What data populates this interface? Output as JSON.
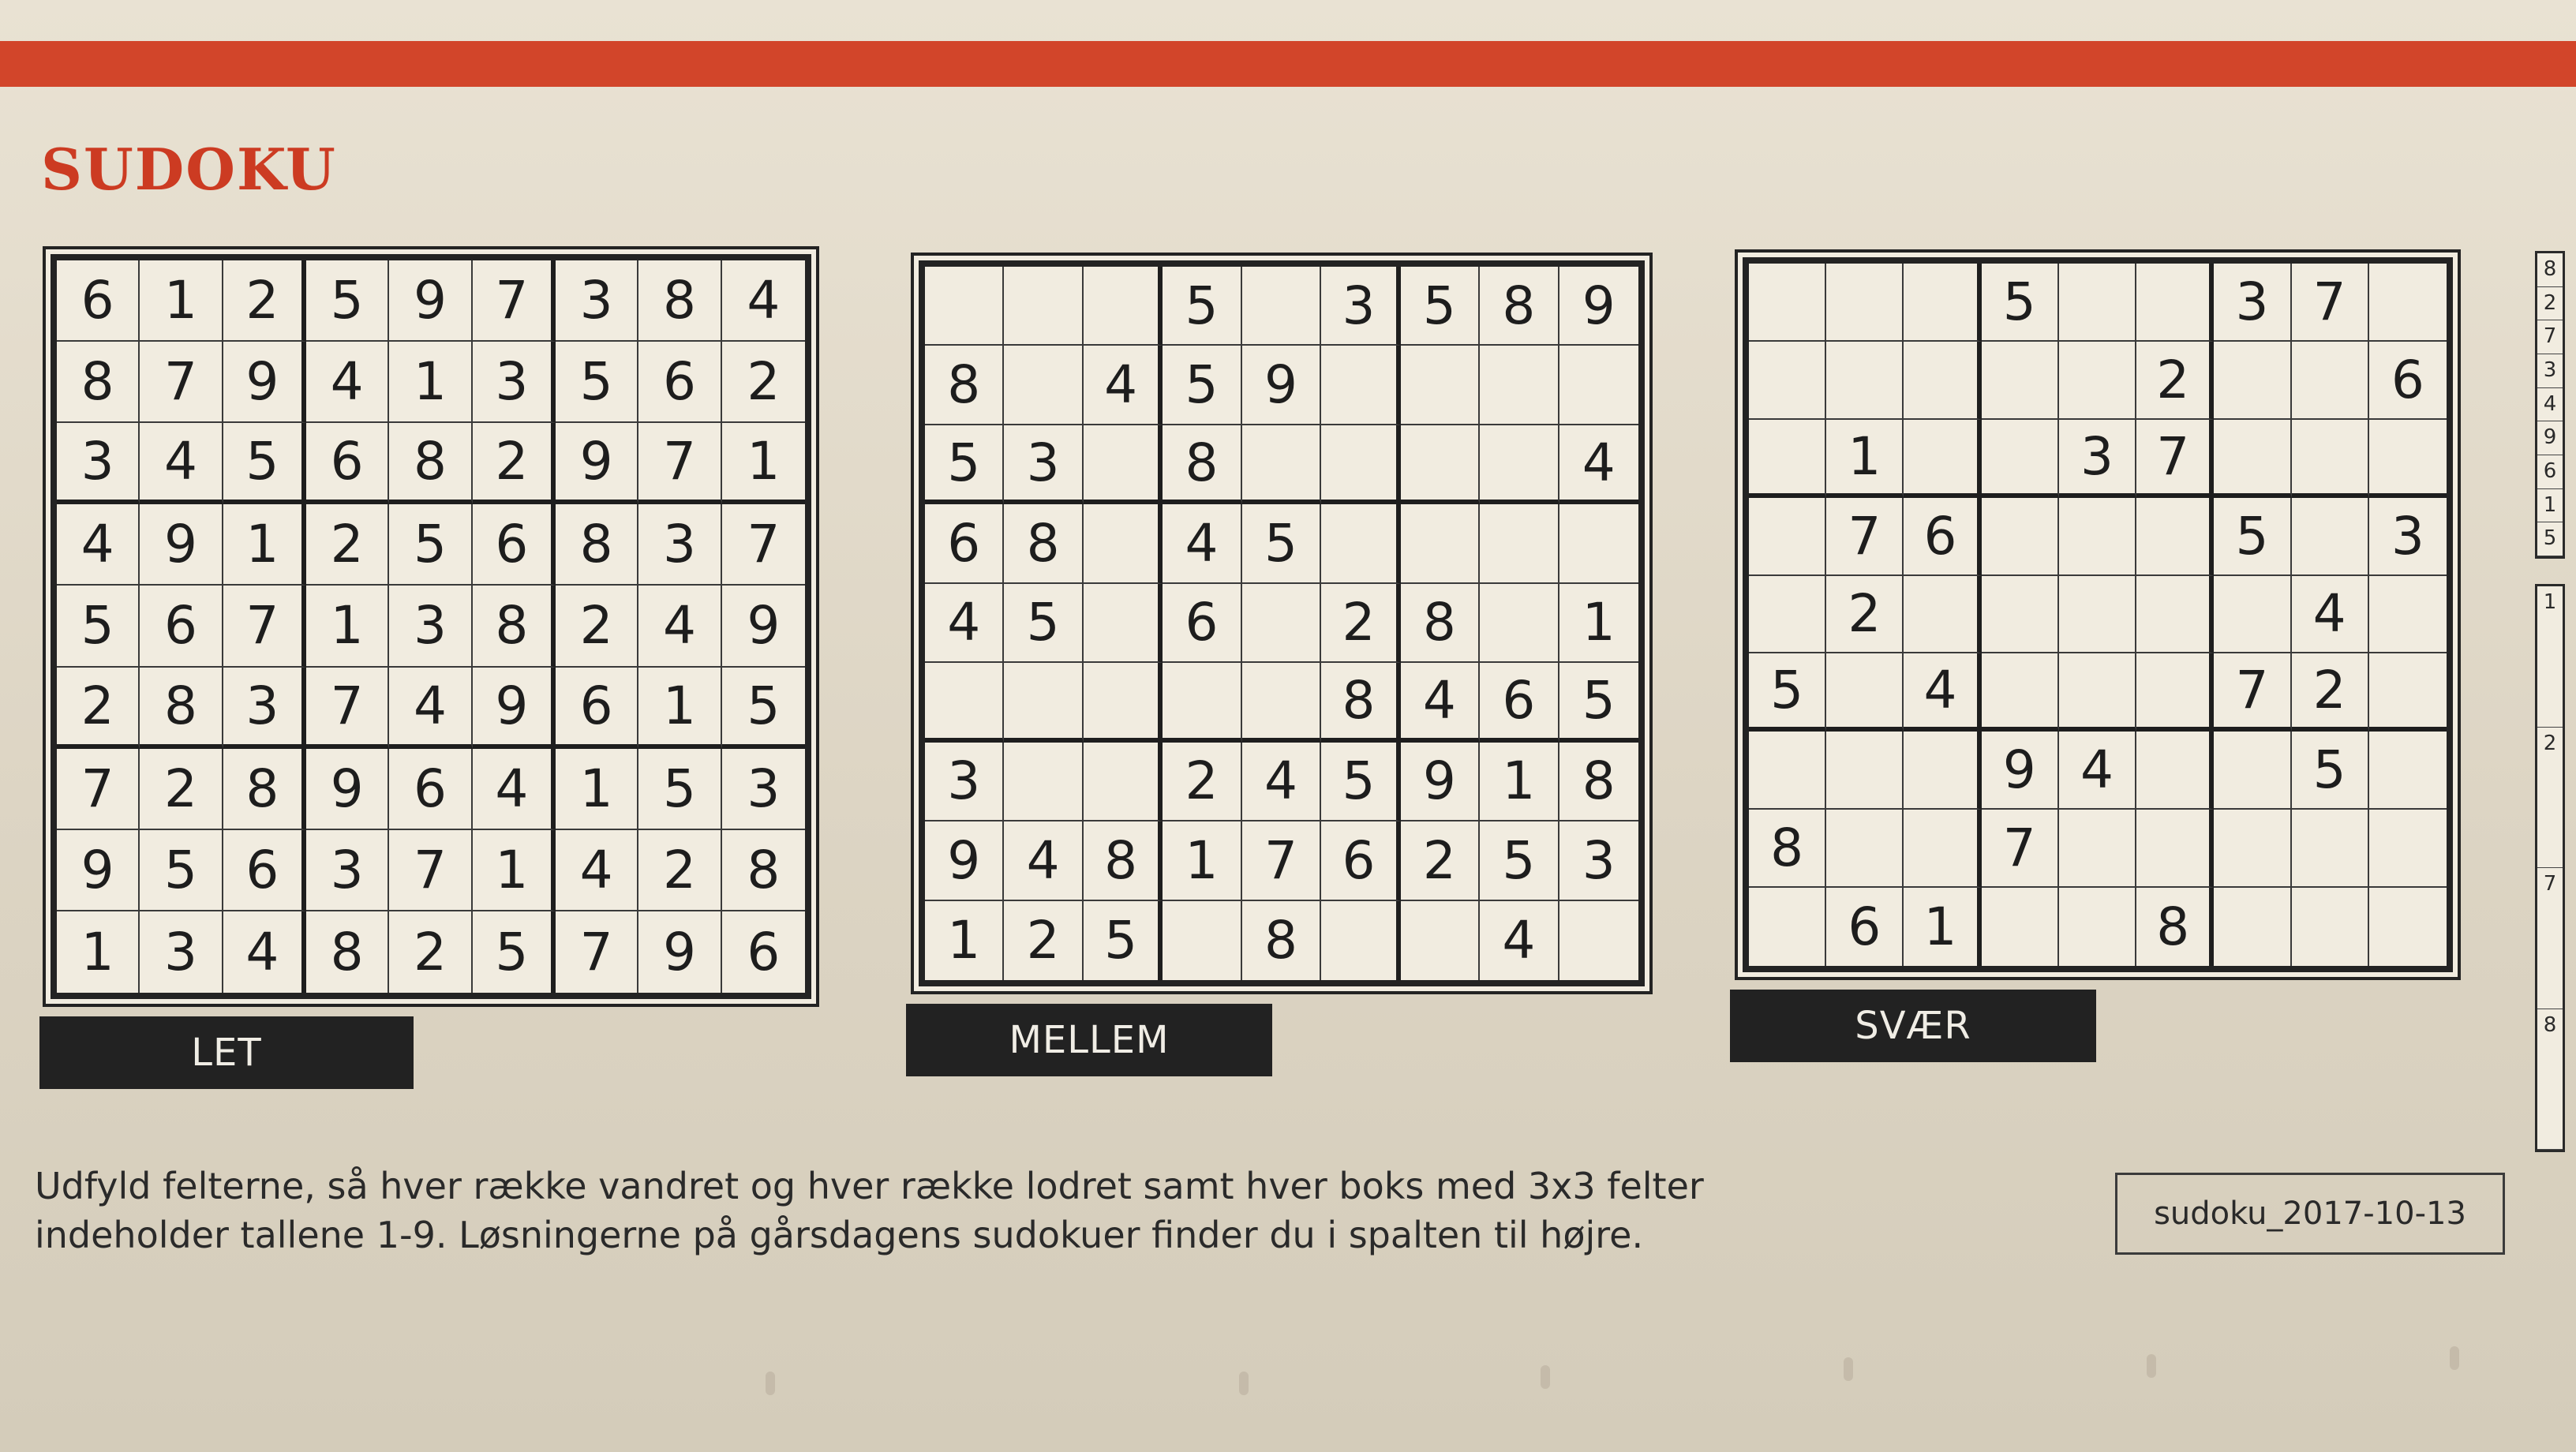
{
  "header": {
    "title": "SUDOKU"
  },
  "puzzles": [
    {
      "label": "LET",
      "grid": [
        [
          "6",
          "1",
          "2",
          "5",
          "9",
          "7",
          "3",
          "8",
          "4"
        ],
        [
          "8",
          "7",
          "9",
          "4",
          "1",
          "3",
          "5",
          "6",
          "2"
        ],
        [
          "3",
          "4",
          "5",
          "6",
          "8",
          "2",
          "9",
          "7",
          "1"
        ],
        [
          "4",
          "9",
          "1",
          "2",
          "5",
          "6",
          "8",
          "3",
          "7"
        ],
        [
          "5",
          "6",
          "7",
          "1",
          "3",
          "8",
          "2",
          "4",
          "9"
        ],
        [
          "2",
          "8",
          "3",
          "7",
          "4",
          "9",
          "6",
          "1",
          "5"
        ],
        [
          "7",
          "2",
          "8",
          "9",
          "6",
          "4",
          "1",
          "5",
          "3"
        ],
        [
          "9",
          "5",
          "6",
          "3",
          "7",
          "1",
          "4",
          "2",
          "8"
        ],
        [
          "1",
          "3",
          "4",
          "8",
          "2",
          "5",
          "7",
          "9",
          "6"
        ]
      ]
    },
    {
      "label": "MELLEM",
      "grid": [
        [
          "",
          "",
          "",
          "5",
          "",
          "3",
          "5",
          "8",
          "9"
        ],
        [
          "8",
          "",
          "4",
          "5",
          "9",
          "",
          "",
          "",
          ""
        ],
        [
          "5",
          "3",
          "",
          "8",
          "",
          "",
          "",
          "",
          "4"
        ],
        [
          "6",
          "8",
          "",
          "4",
          "5",
          "",
          "",
          "",
          ""
        ],
        [
          "4",
          "5",
          "",
          "6",
          "",
          "2",
          "8",
          "",
          "1"
        ],
        [
          "",
          "",
          "",
          "",
          "",
          "8",
          "4",
          "6",
          "5"
        ],
        [
          "3",
          "",
          "",
          "2",
          "4",
          "5",
          "9",
          "1",
          "8"
        ],
        [
          "9",
          "4",
          "8",
          "1",
          "7",
          "6",
          "2",
          "5",
          "3"
        ],
        [
          "1",
          "2",
          "5",
          "",
          "8",
          "",
          "",
          "4",
          ""
        ]
      ]
    },
    {
      "label": "SVÆR",
      "grid": [
        [
          "",
          "",
          "",
          "5",
          "",
          "",
          "3",
          "7",
          ""
        ],
        [
          "",
          "",
          "",
          "",
          "",
          "2",
          "",
          "",
          "6"
        ],
        [
          "",
          "1",
          "",
          "",
          "3",
          "7",
          "",
          "",
          ""
        ],
        [
          "",
          "7",
          "6",
          "",
          "",
          "",
          "5",
          "",
          "3"
        ],
        [
          "",
          "2",
          "",
          "",
          "",
          "",
          "",
          "4",
          ""
        ],
        [
          "5",
          "",
          "4",
          "",
          "",
          "",
          "7",
          "2",
          ""
        ],
        [
          "",
          "",
          "",
          "9",
          "4",
          "",
          "",
          "5",
          ""
        ],
        [
          "8",
          "",
          "",
          "7",
          "",
          "",
          "",
          "",
          ""
        ],
        [
          "",
          "6",
          "1",
          "",
          "",
          "8",
          "",
          "",
          ""
        ]
      ]
    }
  ],
  "instructions": {
    "line1": "Udfyld felterne, så hver række vandret og hver række lodret samt hver boks med 3x3 felter",
    "line2": "indeholder tallene 1-9. Løsningerne på gårsdagens sudokuer finder du i spalten til højre."
  },
  "date_label": "sudoku_2017-10-13",
  "side_solutions": {
    "column_top": [
      "8",
      "2",
      "7",
      "3",
      "4",
      "9",
      "6",
      "1",
      "5"
    ],
    "column_bottom": [
      "1",
      "2",
      "7",
      "8"
    ]
  }
}
